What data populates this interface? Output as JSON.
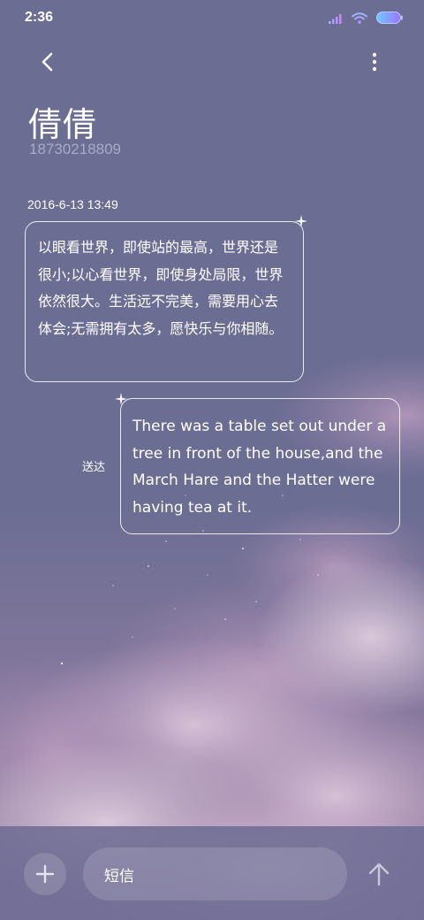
{
  "status_bar": {
    "time": "2:36",
    "icons": [
      "signal-icon",
      "wifi-icon",
      "battery-icon"
    ]
  },
  "header": {
    "back_icon": "chevron-left-icon",
    "more_icon": "more-vertical-icon",
    "contact_name": "倩倩",
    "contact_number": "18730218809"
  },
  "conversation": {
    "timestamp": "2016-6-13 13:49",
    "messages": [
      {
        "direction": "incoming",
        "text": "以眼看世界，即使站的最高，世界还是很小;以心看世界，即使身处局限，世界依然很大。生活远不完美，需要用心去体会;无需拥有太多，愿快乐与你相随。"
      },
      {
        "direction": "outgoing",
        "text": "There was a table set out under a tree in front of the house,and the March Hare and the Hatter were having tea at it.",
        "status": "送达"
      }
    ]
  },
  "composer": {
    "add_icon": "plus-icon",
    "placeholder": "短信",
    "send_icon": "arrow-up-icon"
  },
  "colors": {
    "background": "#6c6d93",
    "secondary_text": "#a9a9c6",
    "battery": "#7b8cff"
  }
}
